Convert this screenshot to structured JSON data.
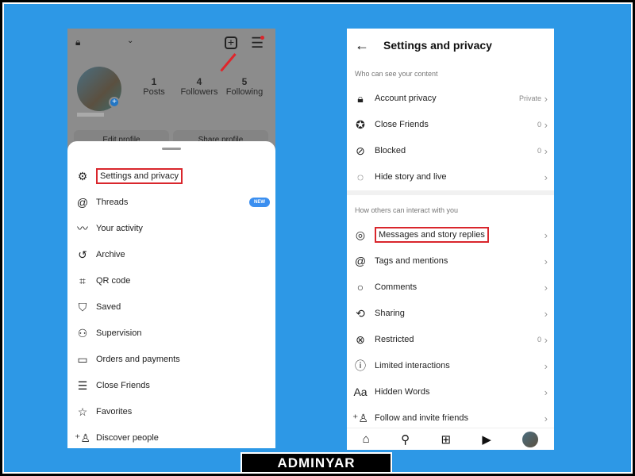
{
  "left": {
    "profile": {
      "posts_count": "1",
      "posts_label": "Posts",
      "followers_count": "4",
      "followers_label": "Followers",
      "following_count": "5",
      "following_label": "Following",
      "edit_profile": "Edit profile",
      "share_profile": "Share profile"
    },
    "menu": [
      {
        "label": "Settings and privacy",
        "icon": "gear-icon",
        "highlighted": true
      },
      {
        "label": "Threads",
        "icon": "threads-icon",
        "badge": "NEW"
      },
      {
        "label": "Your activity",
        "icon": "activity-icon"
      },
      {
        "label": "Archive",
        "icon": "archive-icon"
      },
      {
        "label": "QR code",
        "icon": "qr-code-icon"
      },
      {
        "label": "Saved",
        "icon": "bookmark-icon"
      },
      {
        "label": "Supervision",
        "icon": "supervision-icon"
      },
      {
        "label": "Orders and payments",
        "icon": "card-icon"
      },
      {
        "label": "Close Friends",
        "icon": "list-icon"
      },
      {
        "label": "Favorites",
        "icon": "star-icon"
      },
      {
        "label": "Discover people",
        "icon": "add-person-icon"
      }
    ]
  },
  "right": {
    "title": "Settings and privacy",
    "section1": "Who can see your content",
    "items1": [
      {
        "label": "Account privacy",
        "value": "Private",
        "icon": "lock-icon"
      },
      {
        "label": "Close Friends",
        "value": "0",
        "icon": "star-circle-icon"
      },
      {
        "label": "Blocked",
        "value": "0",
        "icon": "block-icon"
      },
      {
        "label": "Hide story and live",
        "value": "",
        "icon": "hide-story-icon"
      }
    ],
    "section2": "How others can interact with you",
    "items2": [
      {
        "label": "Messages and story replies",
        "value": "",
        "icon": "messenger-icon",
        "highlighted": true
      },
      {
        "label": "Tags and mentions",
        "value": "",
        "icon": "at-icon"
      },
      {
        "label": "Comments",
        "value": "",
        "icon": "comment-icon"
      },
      {
        "label": "Sharing",
        "value": "",
        "icon": "share-icon"
      },
      {
        "label": "Restricted",
        "value": "0",
        "icon": "restricted-icon"
      },
      {
        "label": "Limited interactions",
        "value": "",
        "icon": "limited-icon"
      },
      {
        "label": "Hidden Words",
        "value": "",
        "icon": "text-icon"
      },
      {
        "label": "Follow and invite friends",
        "value": "",
        "icon": "add-person-icon"
      }
    ]
  },
  "watermark": "ADMINYAR",
  "colors": {
    "background": "#2d98e6",
    "highlight": "#d9262c",
    "badge": "#3b8ff0"
  }
}
